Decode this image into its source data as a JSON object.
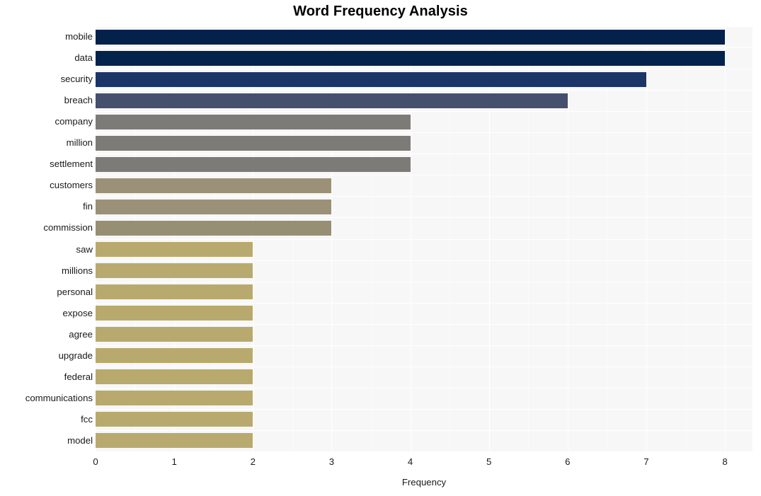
{
  "chart_data": {
    "type": "bar",
    "orientation": "horizontal",
    "title": "Word Frequency Analysis",
    "xlabel": "Frequency",
    "ylabel": "",
    "xlim": [
      0,
      8.35
    ],
    "ylim": [
      0,
      20
    ],
    "grid": true,
    "legend": null,
    "xticks": [
      "0",
      "1",
      "2",
      "3",
      "4",
      "5",
      "6",
      "7",
      "8"
    ],
    "xtick_values": [
      0,
      1,
      2,
      3,
      4,
      5,
      6,
      7,
      8
    ],
    "categories": [
      "mobile",
      "data",
      "security",
      "breach",
      "company",
      "million",
      "settlement",
      "customers",
      "fin",
      "commission",
      "saw",
      "millions",
      "personal",
      "expose",
      "agree",
      "upgrade",
      "federal",
      "communications",
      "fcc",
      "model"
    ],
    "values": [
      8,
      8,
      7,
      6,
      4,
      4,
      4,
      3,
      3,
      3,
      2,
      2,
      2,
      2,
      2,
      2,
      2,
      2,
      2,
      2
    ],
    "bar_colors": [
      "#03214a",
      "#03234c",
      "#1c3568",
      "#454f6e",
      "#7c7b77",
      "#7c7b77",
      "#7c7b77",
      "#9a9178",
      "#9a9178",
      "#978f74",
      "#b8aa6e",
      "#b8aa6e",
      "#b8aa6e",
      "#b8aa6e",
      "#b8aa6e",
      "#b8aa6e",
      "#b8aa6e",
      "#b8aa6e",
      "#b8aa6e",
      "#b8aa6e"
    ],
    "panel_background": "#f7f7f7",
    "grid_color": "#ffffff",
    "figure_background": "#ffffff",
    "text_color": "#1a1a1a"
  }
}
